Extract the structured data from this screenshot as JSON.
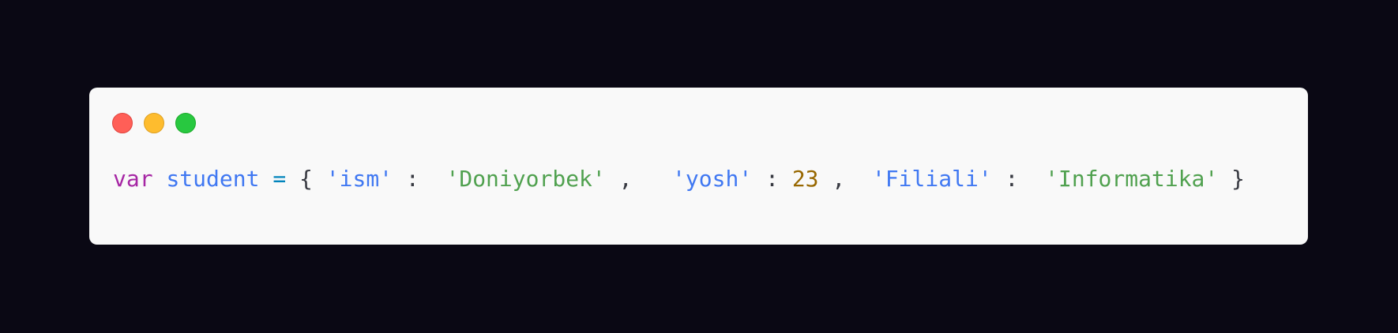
{
  "window": {
    "controls": [
      {
        "name": "close",
        "color": "#ff5f57"
      },
      {
        "name": "minimize",
        "color": "#febc2e"
      },
      {
        "name": "maximize",
        "color": "#28c840"
      }
    ]
  },
  "code": {
    "keyword": "var",
    "variable": "student",
    "assign": "=",
    "open_brace": "{",
    "key1": "'ism'",
    "colon": ":",
    "value1": "'Doniyorbek'",
    "comma": ",",
    "key2": "'yosh'",
    "value2": "23",
    "key3": "'Filiali'",
    "value3": "'Informatika'",
    "close_brace": "}"
  },
  "colors": {
    "background": "#0a0814",
    "card": "#f9f9f9",
    "keyword": "#a626a4",
    "identifier": "#4078f2",
    "string": "#50a14f",
    "number": "#986801"
  }
}
